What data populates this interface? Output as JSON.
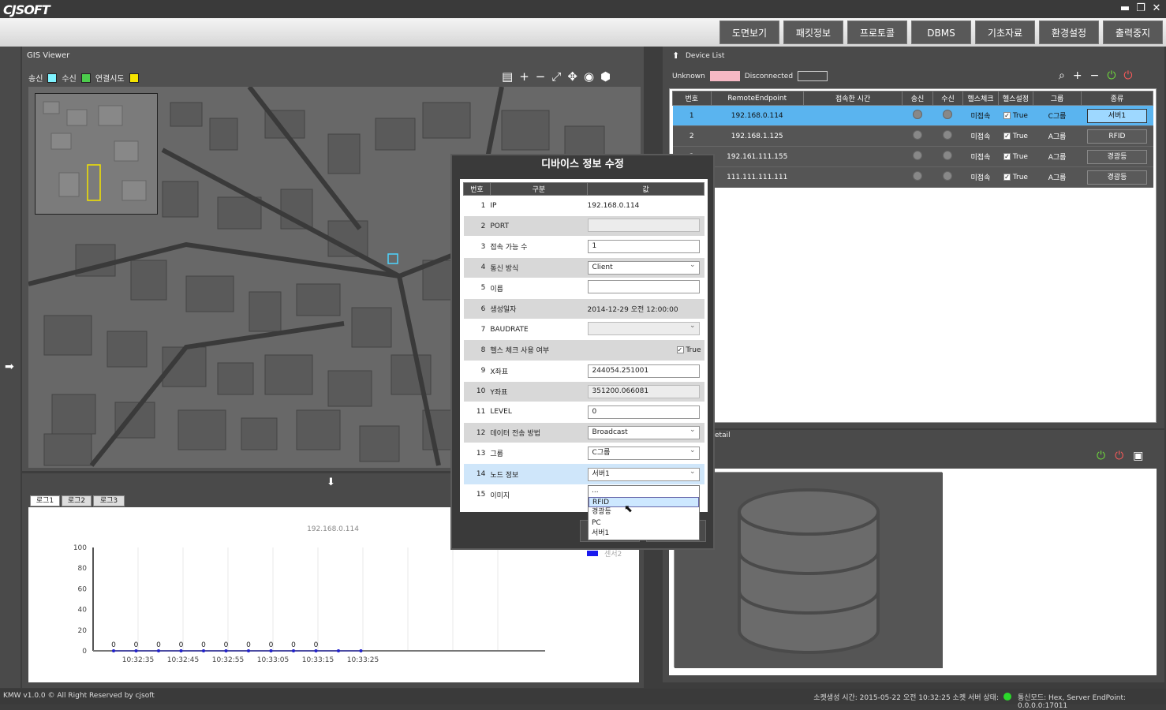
{
  "app": {
    "logo": "CJSOFT",
    "min": "▬",
    "max": "❐",
    "close": "✕"
  },
  "menu": [
    "도면보기",
    "패킷정보",
    "프로토콜",
    "DBMS",
    "기초자료",
    "환경설정",
    "출력중지"
  ],
  "gis": {
    "title": "GIS Viewer",
    "legend": [
      {
        "label": "송신",
        "color": "#7ff3ff"
      },
      {
        "label": "수신",
        "color": "#4ccc4c"
      },
      {
        "label": "연결시도",
        "color": "#f5e400"
      }
    ]
  },
  "log": {
    "tabs": [
      "로그1",
      "로그2",
      "로그3"
    ],
    "arrow": "⬇"
  },
  "chart_data": {
    "type": "line",
    "title": "192.168.0.114",
    "x": [
      "10:32:35",
      "10:32:45",
      "10:32:55",
      "10:33:05",
      "10:33:15",
      "10:33:25"
    ],
    "yticks": [
      0,
      20,
      40,
      60,
      80,
      100
    ],
    "ylim": [
      0,
      100
    ],
    "series": [
      {
        "name": "센서2",
        "values": [
          0,
          0,
          0,
          0,
          0,
          0,
          0,
          0,
          0,
          0,
          0,
          0
        ]
      }
    ],
    "data_labels": [
      "0",
      "0",
      "0",
      "0",
      "0",
      "0",
      "0",
      "0",
      "0",
      "0",
      "0",
      "0"
    ]
  },
  "devices": {
    "title": "Device List",
    "legend": [
      {
        "label": "Unknown",
        "color": "#f6b8c4"
      },
      {
        "label": "Disconnected",
        "color": "#4a4a4a"
      }
    ],
    "columns": [
      "번호",
      "RemoteEndpoint",
      "접속한 시간",
      "송신",
      "수신",
      "헬스체크",
      "헬스설정",
      "그룹",
      "종류"
    ],
    "rows": [
      {
        "no": "1",
        "ep": "192.168.0.114",
        "time": "",
        "hc": "미접속",
        "hs": "True",
        "group": "C그룹",
        "kind": "서버1",
        "selected": true
      },
      {
        "no": "2",
        "ep": "192.168.1.125",
        "time": "",
        "hc": "미접속",
        "hs": "True",
        "group": "A그룹",
        "kind": "RFID"
      },
      {
        "no": "3",
        "ep": "192.161.111.155",
        "time": "",
        "hc": "미접속",
        "hs": "True",
        "group": "A그룹",
        "kind": "경광등"
      },
      {
        "no": "4",
        "ep": "111.111.111.111",
        "time": "",
        "hc": "미접속",
        "hs": "True",
        "group": "A그룹",
        "kind": "경광등"
      }
    ]
  },
  "detail": {
    "title": "etail"
  },
  "dialog": {
    "title": "디바이스 정보 수정",
    "columns": [
      "번호",
      "구분",
      "값"
    ],
    "rows": [
      {
        "n": "1",
        "k": "IP",
        "v": "192.168.0.114",
        "type": "text"
      },
      {
        "n": "2",
        "k": "PORT",
        "v": "",
        "type": "disabled"
      },
      {
        "n": "3",
        "k": "접속 가능 수",
        "v": "1",
        "type": "input"
      },
      {
        "n": "4",
        "k": "통신 방식",
        "v": "Client",
        "type": "dropdown"
      },
      {
        "n": "5",
        "k": "이름",
        "v": "",
        "type": "input"
      },
      {
        "n": "6",
        "k": "생성일자",
        "v": "2014-12-29 오전 12:00:00",
        "type": "text"
      },
      {
        "n": "7",
        "k": "BAUDRATE",
        "v": "",
        "type": "disabled-dd"
      },
      {
        "n": "8",
        "k": "헬스 체크 사용 여부",
        "v": "True",
        "type": "check"
      },
      {
        "n": "9",
        "k": "X좌표",
        "v": "244054.251001",
        "type": "input"
      },
      {
        "n": "10",
        "k": "Y좌표",
        "v": "351200.066081",
        "type": "disabled"
      },
      {
        "n": "11",
        "k": "LEVEL",
        "v": "0",
        "type": "input"
      },
      {
        "n": "12",
        "k": "데이터 전송 방법",
        "v": "Broadcast",
        "type": "dropdown"
      },
      {
        "n": "13",
        "k": "그룹",
        "v": "C그룹",
        "type": "dropdown"
      },
      {
        "n": "14",
        "k": "노드 정보",
        "v": "서버1",
        "type": "dropdown"
      },
      {
        "n": "15",
        "k": "이미지",
        "v": "",
        "type": "text"
      }
    ],
    "dropdown_options": [
      "...",
      "RFID",
      "경광등",
      "PC",
      "서버1"
    ],
    "dropdown_selected": "RFID"
  },
  "status": {
    "left": "KMW v1.0.0 © All Right Reserved by cjsoft",
    "right": "소켓생성 시간: 2015-05-22 오전 10:32:25  소켓 서버 상태:",
    "mode": "통신모드: Hex, Server EndPoint: 0.0.0.0:17011"
  }
}
